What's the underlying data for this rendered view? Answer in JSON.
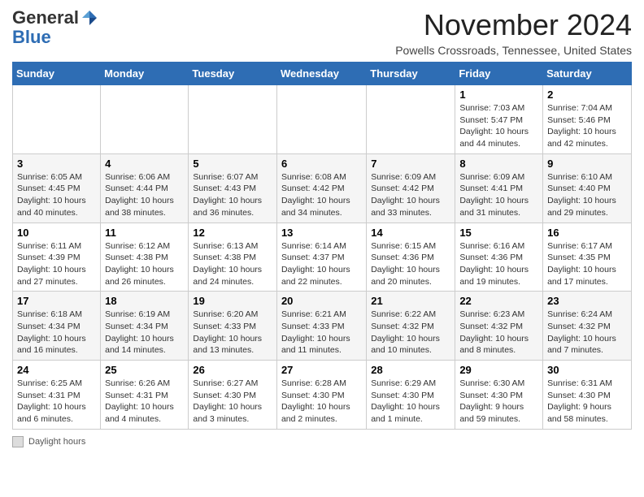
{
  "header": {
    "logo_general": "General",
    "logo_blue": "Blue",
    "month_title": "November 2024",
    "location": "Powells Crossroads, Tennessee, United States"
  },
  "weekdays": [
    "Sunday",
    "Monday",
    "Tuesday",
    "Wednesday",
    "Thursday",
    "Friday",
    "Saturday"
  ],
  "weeks": [
    [
      {
        "day": "",
        "info": ""
      },
      {
        "day": "",
        "info": ""
      },
      {
        "day": "",
        "info": ""
      },
      {
        "day": "",
        "info": ""
      },
      {
        "day": "",
        "info": ""
      },
      {
        "day": "1",
        "info": "Sunrise: 7:03 AM\nSunset: 5:47 PM\nDaylight: 10 hours and 44 minutes."
      },
      {
        "day": "2",
        "info": "Sunrise: 7:04 AM\nSunset: 5:46 PM\nDaylight: 10 hours and 42 minutes."
      }
    ],
    [
      {
        "day": "3",
        "info": "Sunrise: 6:05 AM\nSunset: 4:45 PM\nDaylight: 10 hours and 40 minutes."
      },
      {
        "day": "4",
        "info": "Sunrise: 6:06 AM\nSunset: 4:44 PM\nDaylight: 10 hours and 38 minutes."
      },
      {
        "day": "5",
        "info": "Sunrise: 6:07 AM\nSunset: 4:43 PM\nDaylight: 10 hours and 36 minutes."
      },
      {
        "day": "6",
        "info": "Sunrise: 6:08 AM\nSunset: 4:42 PM\nDaylight: 10 hours and 34 minutes."
      },
      {
        "day": "7",
        "info": "Sunrise: 6:09 AM\nSunset: 4:42 PM\nDaylight: 10 hours and 33 minutes."
      },
      {
        "day": "8",
        "info": "Sunrise: 6:09 AM\nSunset: 4:41 PM\nDaylight: 10 hours and 31 minutes."
      },
      {
        "day": "9",
        "info": "Sunrise: 6:10 AM\nSunset: 4:40 PM\nDaylight: 10 hours and 29 minutes."
      }
    ],
    [
      {
        "day": "10",
        "info": "Sunrise: 6:11 AM\nSunset: 4:39 PM\nDaylight: 10 hours and 27 minutes."
      },
      {
        "day": "11",
        "info": "Sunrise: 6:12 AM\nSunset: 4:38 PM\nDaylight: 10 hours and 26 minutes."
      },
      {
        "day": "12",
        "info": "Sunrise: 6:13 AM\nSunset: 4:38 PM\nDaylight: 10 hours and 24 minutes."
      },
      {
        "day": "13",
        "info": "Sunrise: 6:14 AM\nSunset: 4:37 PM\nDaylight: 10 hours and 22 minutes."
      },
      {
        "day": "14",
        "info": "Sunrise: 6:15 AM\nSunset: 4:36 PM\nDaylight: 10 hours and 20 minutes."
      },
      {
        "day": "15",
        "info": "Sunrise: 6:16 AM\nSunset: 4:36 PM\nDaylight: 10 hours and 19 minutes."
      },
      {
        "day": "16",
        "info": "Sunrise: 6:17 AM\nSunset: 4:35 PM\nDaylight: 10 hours and 17 minutes."
      }
    ],
    [
      {
        "day": "17",
        "info": "Sunrise: 6:18 AM\nSunset: 4:34 PM\nDaylight: 10 hours and 16 minutes."
      },
      {
        "day": "18",
        "info": "Sunrise: 6:19 AM\nSunset: 4:34 PM\nDaylight: 10 hours and 14 minutes."
      },
      {
        "day": "19",
        "info": "Sunrise: 6:20 AM\nSunset: 4:33 PM\nDaylight: 10 hours and 13 minutes."
      },
      {
        "day": "20",
        "info": "Sunrise: 6:21 AM\nSunset: 4:33 PM\nDaylight: 10 hours and 11 minutes."
      },
      {
        "day": "21",
        "info": "Sunrise: 6:22 AM\nSunset: 4:32 PM\nDaylight: 10 hours and 10 minutes."
      },
      {
        "day": "22",
        "info": "Sunrise: 6:23 AM\nSunset: 4:32 PM\nDaylight: 10 hours and 8 minutes."
      },
      {
        "day": "23",
        "info": "Sunrise: 6:24 AM\nSunset: 4:32 PM\nDaylight: 10 hours and 7 minutes."
      }
    ],
    [
      {
        "day": "24",
        "info": "Sunrise: 6:25 AM\nSunset: 4:31 PM\nDaylight: 10 hours and 6 minutes."
      },
      {
        "day": "25",
        "info": "Sunrise: 6:26 AM\nSunset: 4:31 PM\nDaylight: 10 hours and 4 minutes."
      },
      {
        "day": "26",
        "info": "Sunrise: 6:27 AM\nSunset: 4:30 PM\nDaylight: 10 hours and 3 minutes."
      },
      {
        "day": "27",
        "info": "Sunrise: 6:28 AM\nSunset: 4:30 PM\nDaylight: 10 hours and 2 minutes."
      },
      {
        "day": "28",
        "info": "Sunrise: 6:29 AM\nSunset: 4:30 PM\nDaylight: 10 hours and 1 minute."
      },
      {
        "day": "29",
        "info": "Sunrise: 6:30 AM\nSunset: 4:30 PM\nDaylight: 9 hours and 59 minutes."
      },
      {
        "day": "30",
        "info": "Sunrise: 6:31 AM\nSunset: 4:30 PM\nDaylight: 9 hours and 58 minutes."
      }
    ]
  ],
  "footer": {
    "daylight_label": "Daylight hours"
  }
}
